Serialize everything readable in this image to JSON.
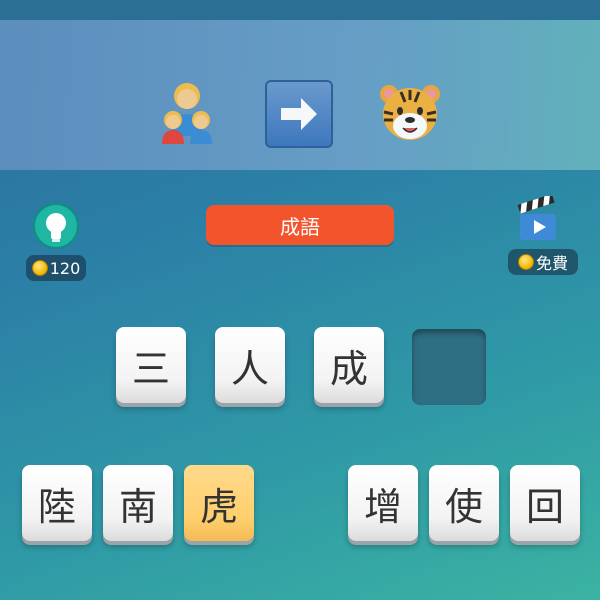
{
  "clue": {
    "items": [
      {
        "icon": "family-icon"
      },
      {
        "icon": "right-arrow-icon"
      },
      {
        "icon": "tiger-face-icon"
      }
    ]
  },
  "hint": {
    "icon": "lightbulb-icon",
    "coins": "120"
  },
  "category": {
    "label": "成語"
  },
  "video": {
    "icon": "clapperboard-icon",
    "label": "免費"
  },
  "answer": {
    "chars": [
      "三",
      "人",
      "成",
      ""
    ]
  },
  "letters": {
    "row": [
      "陸",
      "南",
      "虎",
      "",
      "增",
      "使",
      "回"
    ],
    "selected_index": 2
  },
  "colors": {
    "category_bg": "#f2552c",
    "selected_tile": "#ffcf6e",
    "empty_slot": "#2f6f84"
  }
}
